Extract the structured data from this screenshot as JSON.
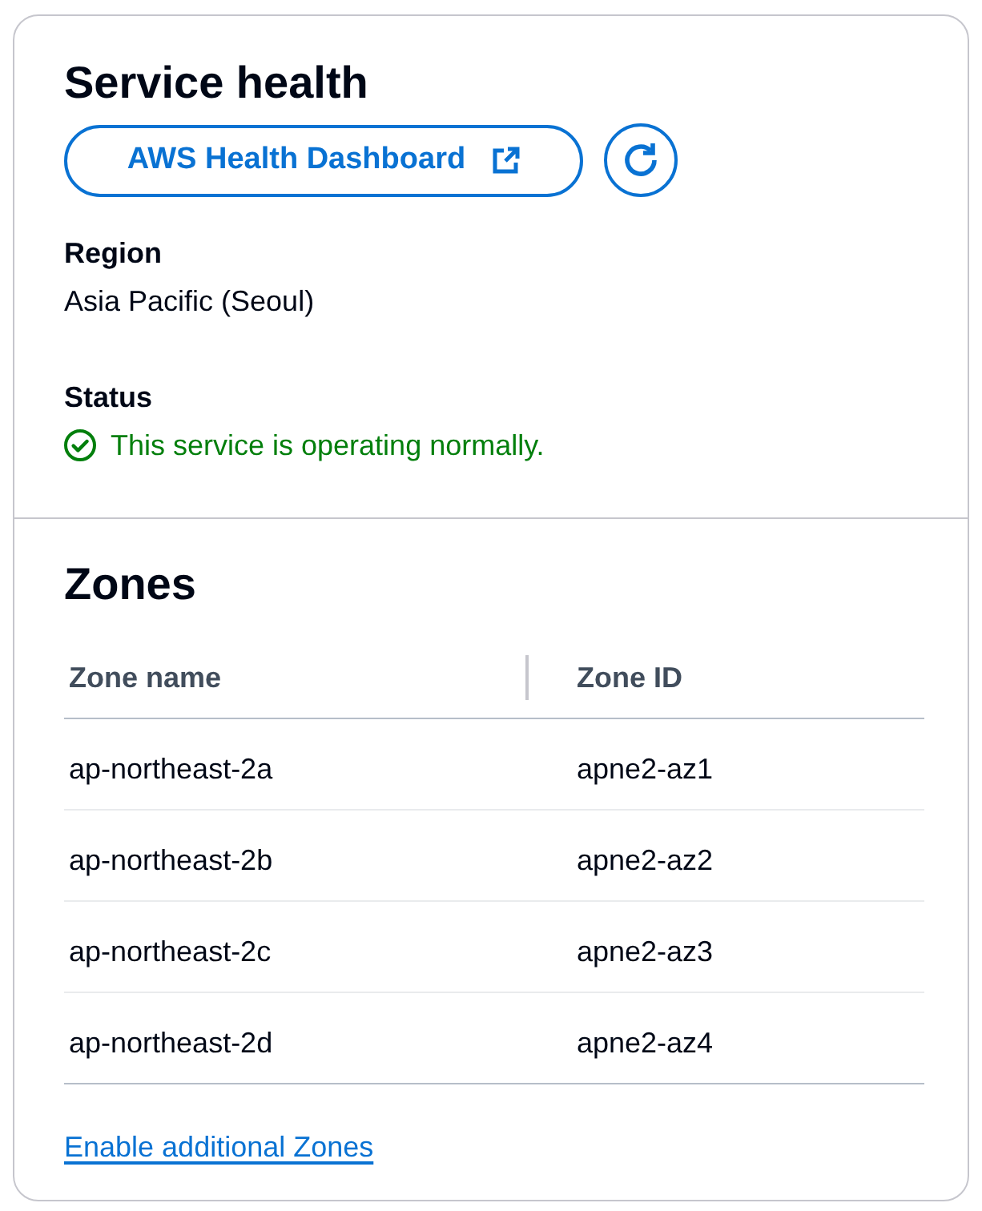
{
  "service_health": {
    "title": "Service health",
    "dashboard_button": {
      "label": "AWS Health Dashboard"
    },
    "fields": [
      {
        "kind": "text",
        "label": "Region",
        "value": "Asia Pacific (Seoul)"
      },
      {
        "kind": "status",
        "label": "Status",
        "value": "This service is operating normally."
      }
    ]
  },
  "zones": {
    "title": "Zones",
    "columns": [
      "Zone name",
      "Zone ID"
    ],
    "rows": [
      [
        "ap-northeast-2a",
        "apne2-az1"
      ],
      [
        "ap-northeast-2b",
        "apne2-az2"
      ],
      [
        "ap-northeast-2c",
        "apne2-az3"
      ],
      [
        "ap-northeast-2d",
        "apne2-az4"
      ]
    ],
    "link": "Enable additional Zones"
  }
}
